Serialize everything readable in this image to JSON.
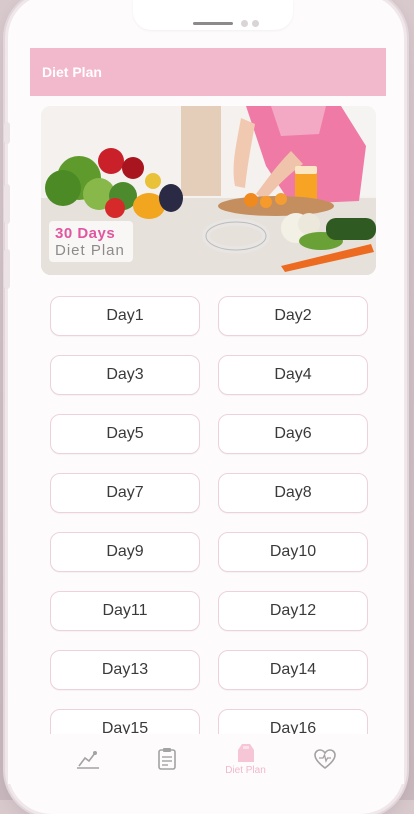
{
  "app": {
    "title": "Diet Plan"
  },
  "banner": {
    "title": "30 Days",
    "subtitle": "Diet Plan"
  },
  "days": [
    {
      "label": "Day1"
    },
    {
      "label": "Day2"
    },
    {
      "label": "Day3"
    },
    {
      "label": "Day4"
    },
    {
      "label": "Day5"
    },
    {
      "label": "Day6"
    },
    {
      "label": "Day7"
    },
    {
      "label": "Day8"
    },
    {
      "label": "Day9"
    },
    {
      "label": "Day10"
    },
    {
      "label": "Day11"
    },
    {
      "label": "Day12"
    },
    {
      "label": "Day13"
    },
    {
      "label": "Day14"
    },
    {
      "label": "Day15"
    },
    {
      "label": "Day16"
    }
  ],
  "tabs": [
    {
      "icon": "workout-icon",
      "label": "",
      "active": false
    },
    {
      "icon": "calendar-clipboard-icon",
      "label": "",
      "active": false
    },
    {
      "icon": "diet-plan-icon",
      "label": "Diet Plan",
      "active": true
    },
    {
      "icon": "heart-icon",
      "label": "",
      "active": false
    }
  ],
  "colors": {
    "accent": "#f2b8cc",
    "banner_title": "#e056a0",
    "button_border": "#eed1da"
  }
}
